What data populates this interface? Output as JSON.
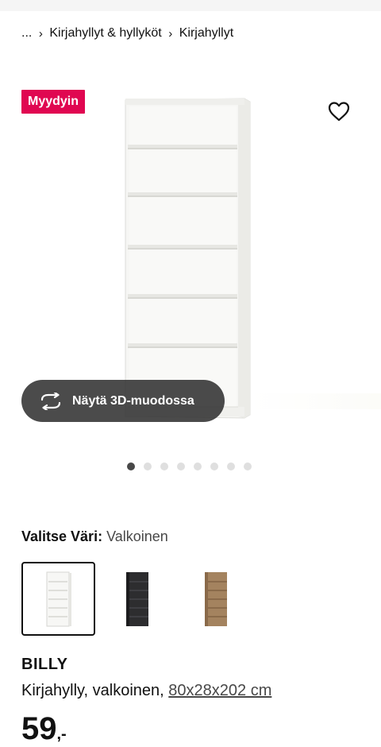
{
  "breadcrumb": {
    "ellipsis": "...",
    "items": [
      "Kirjahyllyt & hyllyköt",
      "Kirjahyllyt"
    ]
  },
  "gallery": {
    "badge": "Myydyin",
    "view_3d_label": "Näytä 3D-muodossa",
    "image_count": 8,
    "active_index": 0
  },
  "color": {
    "label": "Valitse Väri:",
    "value": "Valkoinen",
    "options": [
      {
        "name": "Valkoinen",
        "hex": "#f4f4f2"
      },
      {
        "name": "Musta",
        "hex": "#2b2b2d"
      },
      {
        "name": "Tammi",
        "hex": "#9a7a5a"
      }
    ]
  },
  "product": {
    "name": "BILLY",
    "description": "Kirjahylly, valkoinen,",
    "size": "80x28x202 cm",
    "price_int": "59",
    "price_dec": ",-"
  },
  "colors": {
    "badge_bg": "#e00751",
    "dot_active": "#484848",
    "dot_inactive": "#dfdfdf"
  }
}
